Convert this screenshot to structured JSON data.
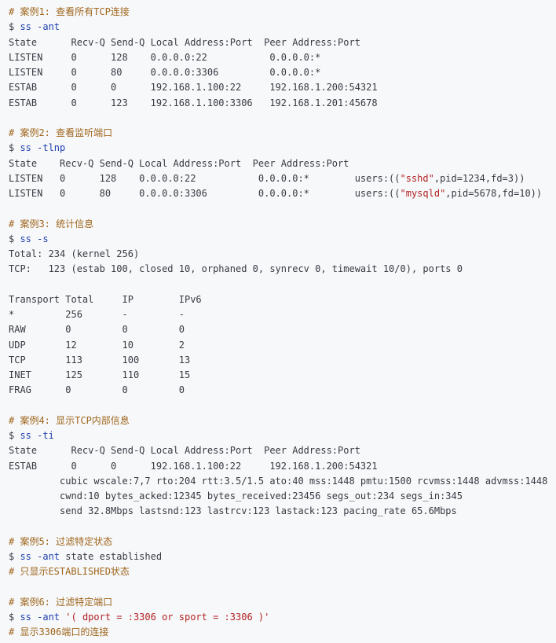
{
  "colors": {
    "background": "#f6f8fa",
    "text": "#383a42",
    "comment": "#a0651b",
    "command": "#1f3fae",
    "string": "#b22222",
    "number": "#2f7a3a"
  },
  "lines": [
    {
      "kind": "comment",
      "text": "# 案例1: 查看所有TCP连接"
    },
    {
      "kind": "cmd",
      "prompt": "$ ",
      "parts": [
        {
          "t": "ss -ant",
          "c": "cmdtext"
        }
      ]
    },
    {
      "kind": "plain",
      "text": "State      Recv-Q Send-Q Local Address:Port  Peer Address:Port"
    },
    {
      "kind": "plain",
      "text": "LISTEN     0      128    0.0.0.0:22           0.0.0.0:*"
    },
    {
      "kind": "plain",
      "text": "LISTEN     0      80     0.0.0.0:3306         0.0.0.0:*"
    },
    {
      "kind": "plain",
      "text": "ESTAB      0      0      192.168.1.100:22     192.168.1.200:54321"
    },
    {
      "kind": "plain",
      "text": "ESTAB      0      123    192.168.1.100:3306   192.168.1.201:45678"
    },
    {
      "kind": "blank"
    },
    {
      "kind": "comment",
      "text": "# 案例2: 查看监听端口"
    },
    {
      "kind": "cmd",
      "prompt": "$ ",
      "parts": [
        {
          "t": "ss -tlnp",
          "c": "cmdtext"
        }
      ]
    },
    {
      "kind": "plain",
      "text": "State    Recv-Q Send-Q Local Address:Port  Peer Address:Port"
    },
    {
      "kind": "mixed",
      "parts": [
        {
          "t": "LISTEN   0      128    0.0.0.0:22           0.0.0.0:*        users:((",
          "c": "plain"
        },
        {
          "t": "\"sshd\"",
          "c": "str"
        },
        {
          "t": ",pid=1234,fd=3))",
          "c": "plain"
        }
      ]
    },
    {
      "kind": "mixed",
      "parts": [
        {
          "t": "LISTEN   0      80     0.0.0.0:3306         0.0.0.0:*        users:((",
          "c": "plain"
        },
        {
          "t": "\"mysqld\"",
          "c": "str"
        },
        {
          "t": ",pid=5678,fd=10))",
          "c": "plain"
        }
      ]
    },
    {
      "kind": "blank"
    },
    {
      "kind": "comment",
      "text": "# 案例3: 统计信息"
    },
    {
      "kind": "cmd",
      "prompt": "$ ",
      "parts": [
        {
          "t": "ss -s",
          "c": "cmdtext"
        }
      ]
    },
    {
      "kind": "plain",
      "text": "Total: 234 (kernel 256)"
    },
    {
      "kind": "plain",
      "text": "TCP:   123 (estab 100, closed 10, orphaned 0, synrecv 0, timewait 10/0), ports 0"
    },
    {
      "kind": "blank"
    },
    {
      "kind": "plain",
      "text": "Transport Total     IP        IPv6"
    },
    {
      "kind": "plain",
      "text": "*         256       -         -"
    },
    {
      "kind": "plain",
      "text": "RAW       0         0         0"
    },
    {
      "kind": "plain",
      "text": "UDP       12        10        2"
    },
    {
      "kind": "plain",
      "text": "TCP       113       100       13"
    },
    {
      "kind": "plain",
      "text": "INET      125       110       15"
    },
    {
      "kind": "plain",
      "text": "FRAG      0         0         0"
    },
    {
      "kind": "blank"
    },
    {
      "kind": "comment",
      "text": "# 案例4: 显示TCP内部信息"
    },
    {
      "kind": "cmd",
      "prompt": "$ ",
      "parts": [
        {
          "t": "ss -ti",
          "c": "cmdtext"
        }
      ]
    },
    {
      "kind": "plain",
      "text": "State      Recv-Q Send-Q Local Address:Port  Peer Address:Port"
    },
    {
      "kind": "plain",
      "text": "ESTAB      0      0      192.168.1.100:22     192.168.1.200:54321"
    },
    {
      "kind": "plain",
      "text": "         cubic wscale:7,7 rto:204 rtt:3.5/1.5 ato:40 mss:1448 pmtu:1500 rcvmss:1448 advmss:1448"
    },
    {
      "kind": "plain",
      "text": "         cwnd:10 bytes_acked:12345 bytes_received:23456 segs_out:234 segs_in:345"
    },
    {
      "kind": "plain",
      "text": "         send 32.8Mbps lastsnd:123 lastrcv:123 lastack:123 pacing_rate 65.6Mbps"
    },
    {
      "kind": "blank"
    },
    {
      "kind": "comment",
      "text": "# 案例5: 过滤特定状态"
    },
    {
      "kind": "cmd",
      "prompt": "$ ",
      "parts": [
        {
          "t": "ss -ant",
          "c": "cmdtext"
        },
        {
          "t": " state established",
          "c": "plain"
        }
      ]
    },
    {
      "kind": "comment",
      "text": "# 只显示ESTABLISHED状态"
    },
    {
      "kind": "blank"
    },
    {
      "kind": "comment",
      "text": "# 案例6: 过滤特定端口"
    },
    {
      "kind": "cmd",
      "prompt": "$ ",
      "parts": [
        {
          "t": "ss -ant",
          "c": "cmdtext"
        },
        {
          "t": " ",
          "c": "plain"
        },
        {
          "t": "'( dport = :3306 or sport = :3306 )'",
          "c": "str"
        }
      ]
    },
    {
      "kind": "comment",
      "text": "# 显示3306端口的连接"
    }
  ]
}
